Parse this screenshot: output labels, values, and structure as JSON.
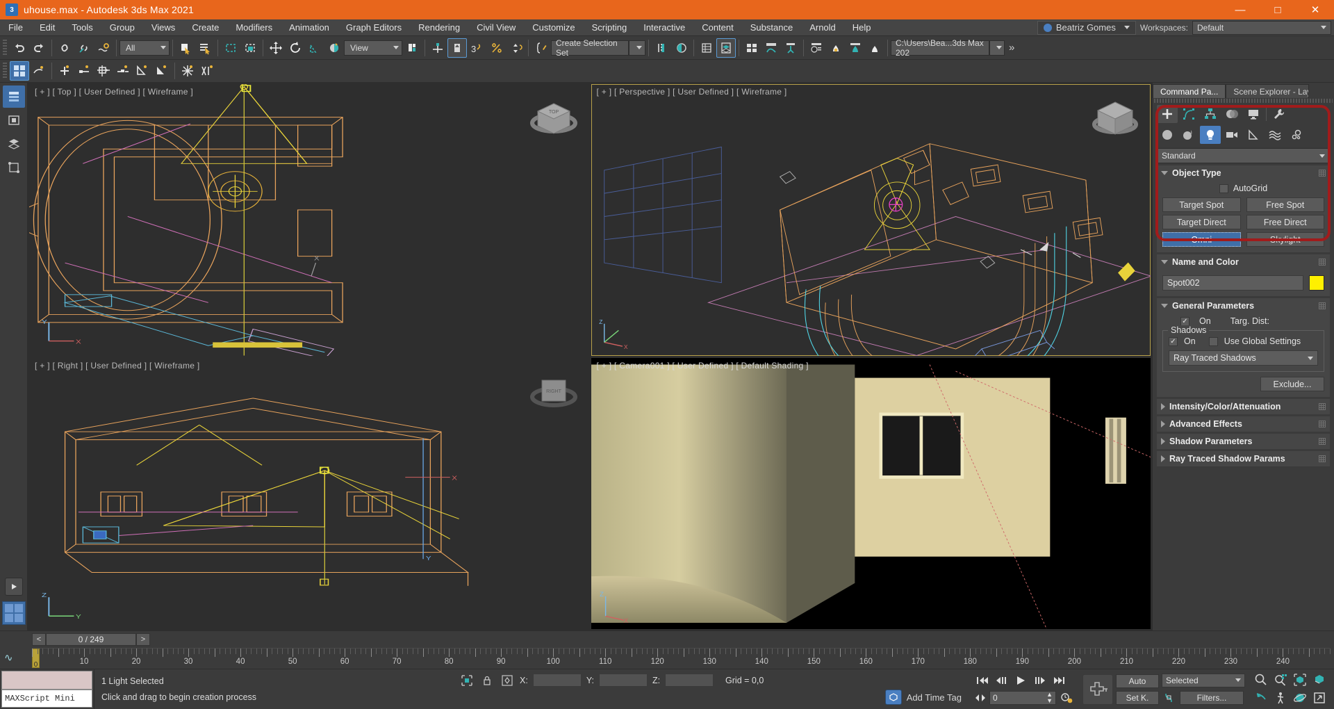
{
  "window": {
    "title": "uhouse.max - Autodesk 3ds Max 2021",
    "app_icon": "3dsmax-icon",
    "minimize": "minimize-icon",
    "maximize": "maximize-icon",
    "close": "close-icon"
  },
  "menubar": {
    "items": [
      "File",
      "Edit",
      "Tools",
      "Group",
      "Views",
      "Create",
      "Modifiers",
      "Animation",
      "Graph Editors",
      "Rendering",
      "Civil View",
      "Customize",
      "Scripting",
      "Interactive",
      "Content",
      "Substance",
      "Arnold",
      "Help"
    ],
    "user": "Beatriz Gomes",
    "workspaces_label": "Workspaces:",
    "workspace_value": "Default"
  },
  "toolbar": {
    "selection_filter": "All",
    "reference_coord": "View",
    "selection_set_placeholder": "Create Selection Set",
    "project_path": "C:\\Users\\Bea...3ds Max 202",
    "overflow": "»",
    "icons": [
      "undo-icon",
      "redo-icon",
      "select-link-icon",
      "unlink-icon",
      "bind-space-warp-icon",
      "select-object-icon",
      "select-by-name-icon",
      "rectangular-select-region-icon",
      "window-crossing-icon",
      "select-and-move-icon",
      "select-and-rotate-icon",
      "select-and-scale-icon",
      "select-and-place-icon",
      "use-pivot-center-icon",
      "select-and-manipulate-icon",
      "snaps-toggle-icon",
      "angle-snap-icon",
      "percent-snap-icon",
      "spinner-snap-icon",
      "named-selection-sets-icon",
      "mirror-icon",
      "align-icon",
      "layer-explorer-icon",
      "scene-explorer-icon",
      "ribbon-icon",
      "curve-editor-icon",
      "schematic-view-icon",
      "material-editor-icon",
      "render-setup-icon",
      "render-frame-window-icon",
      "render-production-icon"
    ],
    "row2_icons": [
      "create-helper-icon",
      "tape-icon",
      "dummy-icon",
      "point-icon",
      "protractor-icon",
      "compass-icon",
      "snapshot-icon",
      "array-icon"
    ]
  },
  "left_rail": {
    "items": [
      "layers-icon",
      "isolate-icon",
      "stack-icon",
      "sub-object-icon"
    ],
    "play": "play-icon",
    "grid": "grid-icon"
  },
  "viewports": [
    {
      "name": "viewport-top",
      "label": "[ + ] [ Top ] [ User Defined ] [ Wireframe ]",
      "shading": "Wireframe",
      "view": "Top"
    },
    {
      "name": "viewport-perspective",
      "label": "[ + ] [ Perspective ] [ User Defined ] [ Wireframe ]",
      "shading": "Wireframe",
      "view": "Perspective",
      "active": true
    },
    {
      "name": "viewport-right",
      "label": "[ + ] [ Right ] [ User Defined ] [ Wireframe ]",
      "shading": "Wireframe",
      "view": "Right"
    },
    {
      "name": "viewport-camera",
      "label": "[ + ] [ Camera001 ] [ User Defined ] [ Default Shading ]",
      "shading": "Default Shading",
      "view": "Camera001"
    }
  ],
  "command_panel": {
    "tabs": [
      {
        "label": "Command Pa...",
        "active": true
      },
      {
        "label": "Scene Explorer - Layer Explo...",
        "active": false
      }
    ],
    "main_tabs": [
      "create-tab-icon",
      "modify-tab-icon",
      "hierarchy-tab-icon",
      "motion-tab-icon",
      "display-tab-icon",
      "utilities-tab-icon"
    ],
    "category_icons": [
      "geometry-icon",
      "shapes-icon",
      "lights-icon",
      "cameras-icon",
      "helpers-icon",
      "space-warps-icon",
      "systems-icon"
    ],
    "active_category": "lights-icon",
    "subcategory": "Standard",
    "object_type": {
      "title": "Object Type",
      "autogrid_label": "AutoGrid",
      "autogrid_checked": false,
      "buttons": [
        {
          "label": "Target Spot",
          "active": false
        },
        {
          "label": "Free Spot",
          "active": false
        },
        {
          "label": "Target Direct",
          "active": false
        },
        {
          "label": "Free Direct",
          "active": false
        },
        {
          "label": "Omni",
          "active": true
        },
        {
          "label": "Skylight",
          "active": false
        }
      ]
    },
    "name_and_color": {
      "title": "Name and Color",
      "name": "Spot002",
      "color": "#FFF000"
    },
    "general_parameters": {
      "title": "General Parameters",
      "on_label": "On",
      "on_checked": true,
      "targ_dist_label": "Targ. Dist:",
      "shadows_group": "Shadows",
      "shadows_on_label": "On",
      "shadows_on_checked": true,
      "use_global_label": "Use Global Settings",
      "use_global_checked": false,
      "shadow_type": "Ray Traced Shadows",
      "exclude_label": "Exclude..."
    },
    "collapsed_rollouts": [
      "Intensity/Color/Attenuation",
      "Advanced Effects",
      "Shadow Parameters",
      "Ray Traced Shadow Params"
    ],
    "highlight_color": "#A11B1B"
  },
  "timeline": {
    "prev_label": "<",
    "next_label": ">",
    "frame_display": "0 / 249",
    "current_frame": "0",
    "tick_labels": [
      0,
      10,
      20,
      30,
      40,
      50,
      60,
      70,
      80,
      90,
      100,
      110,
      120,
      130,
      140,
      150,
      160,
      170,
      180,
      190,
      200,
      210,
      220,
      230,
      240
    ],
    "max_ticks": 249
  },
  "statusbar": {
    "maxscript_label": "MAXScript Mini",
    "selection_status": "1 Light Selected",
    "prompt": "Click and drag to begin creation process",
    "x_label": "X:",
    "y_label": "Y:",
    "z_label": "Z:",
    "x_value": "",
    "y_value": "",
    "z_value": "",
    "grid": "Grid = 0,0",
    "add_time_tag": "Add Time Tag",
    "auto_key": "Auto",
    "set_key": "Set K.",
    "key_filter_value": "Selected",
    "filters": "Filters...",
    "spinner_value": "0",
    "playback_icons": [
      "go-to-start-icon",
      "previous-frame-icon",
      "play-animation-icon",
      "next-frame-icon",
      "go-to-end-icon"
    ],
    "nav_icons": [
      "zoom-icon",
      "zoom-all-icon",
      "zoom-extents-icon",
      "zoom-region-icon",
      "pan-icon",
      "walkthrough-icon",
      "orbit-icon",
      "maximize-viewport-icon"
    ]
  }
}
